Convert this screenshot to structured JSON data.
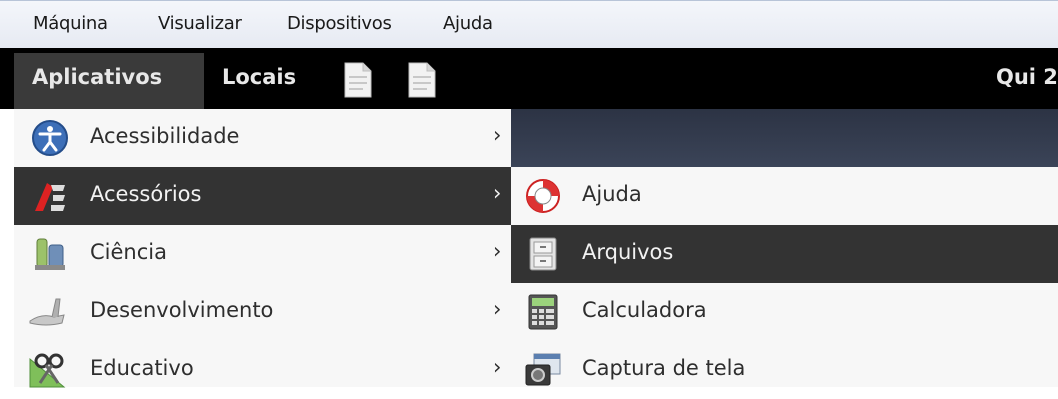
{
  "vbox_menu": [
    "Máquina",
    "Visualizar",
    "Dispositivos",
    "Ajuda"
  ],
  "panel": {
    "applications_label": "Aplicativos",
    "places_label": "Locais",
    "clock": "Qui 2"
  },
  "categories": [
    {
      "label": "Acessibilidade",
      "icon": "accessibility-icon",
      "selected": false
    },
    {
      "label": "Acessórios",
      "icon": "accessories-icon",
      "selected": true
    },
    {
      "label": "Ciência",
      "icon": "science-icon",
      "selected": false
    },
    {
      "label": "Desenvolvimento",
      "icon": "development-icon",
      "selected": false
    },
    {
      "label": "Educativo",
      "icon": "education-icon",
      "selected": false
    }
  ],
  "submenu_items": [
    {
      "label": "Ajuda",
      "icon": "help-lifebuoy-icon",
      "selected": false
    },
    {
      "label": "Arquivos",
      "icon": "file-cabinet-icon",
      "selected": true
    },
    {
      "label": "Calculadora",
      "icon": "calculator-icon",
      "selected": false
    },
    {
      "label": "Captura de tela",
      "icon": "camera-icon",
      "selected": false
    }
  ],
  "arrow_glyph": "›",
  "colors": {
    "panel": "#000000",
    "selected": "#333333",
    "menu_bg": "#f7f7f7"
  }
}
